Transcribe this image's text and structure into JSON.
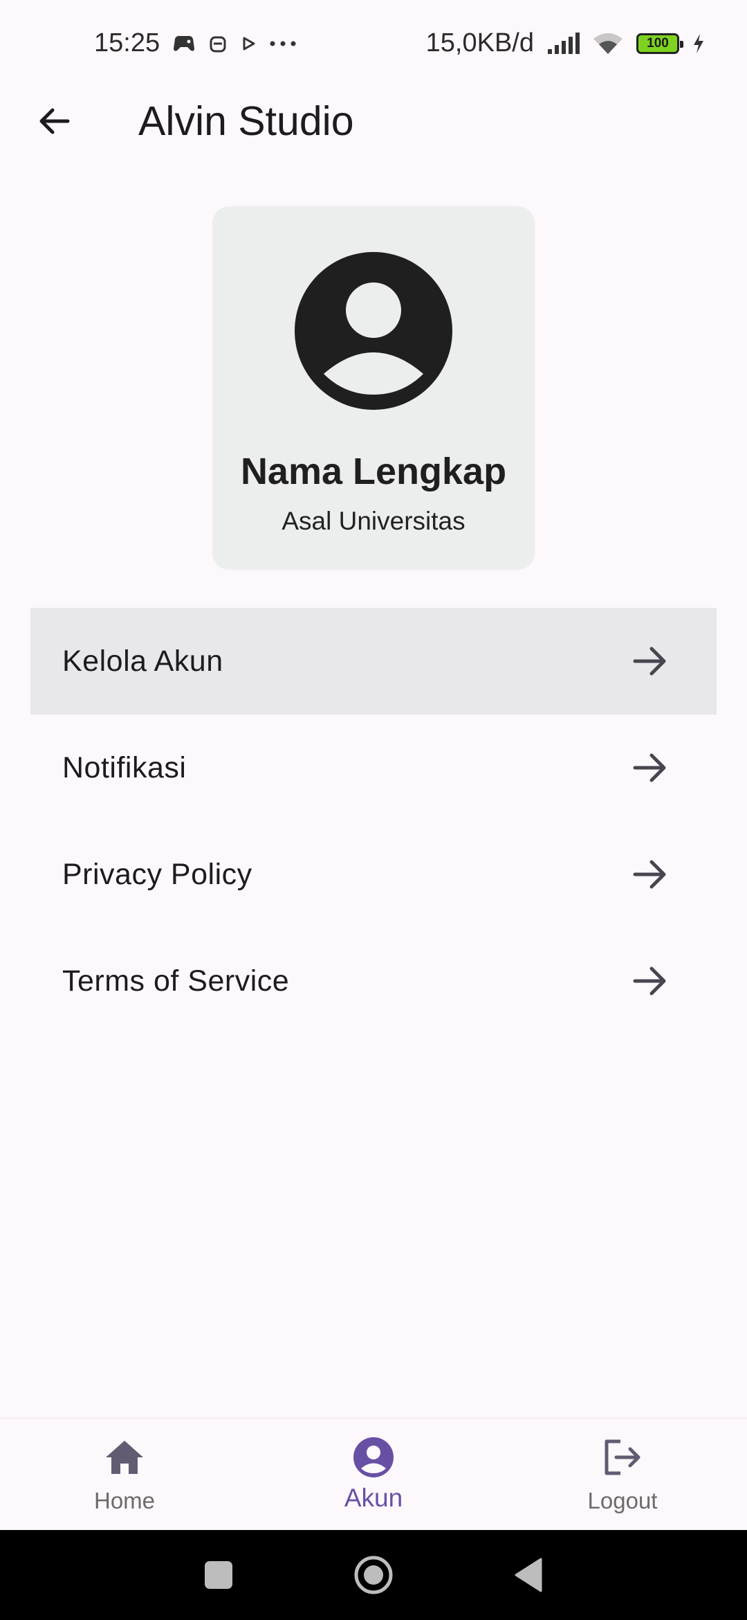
{
  "status_bar": {
    "time": "15:25",
    "network_speed": "15,0KB/d",
    "battery_level": "100",
    "icons": [
      "game-controller-icon",
      "robot-icon",
      "play-icon",
      "more-dots-icon",
      "signal-icon",
      "wifi-icon",
      "battery-icon",
      "charging-icon"
    ]
  },
  "app_bar": {
    "title": "Alvin Studio",
    "back_icon": "arrow-back-icon"
  },
  "profile": {
    "name": "Nama Lengkap",
    "university": "Asal Universitas",
    "avatar_icon": "account-circle-icon"
  },
  "menu": {
    "items": [
      {
        "label": "Kelola Akun",
        "icon": "arrow-forward-icon"
      },
      {
        "label": "Notifikasi",
        "icon": "arrow-forward-icon"
      },
      {
        "label": "Privacy Policy",
        "icon": "arrow-forward-icon"
      },
      {
        "label": "Terms of Service",
        "icon": "arrow-forward-icon"
      }
    ]
  },
  "bottom_nav": {
    "items": [
      {
        "label": "Home",
        "icon": "home-icon"
      },
      {
        "label": "Akun",
        "icon": "account-circle-icon"
      },
      {
        "label": "Logout",
        "icon": "logout-icon"
      }
    ],
    "selected": "Akun"
  },
  "colors": {
    "background": "#fdf8fc",
    "card": "#eceeed",
    "accent": "#6750a4",
    "highlight_row": "#e8e7ea"
  }
}
